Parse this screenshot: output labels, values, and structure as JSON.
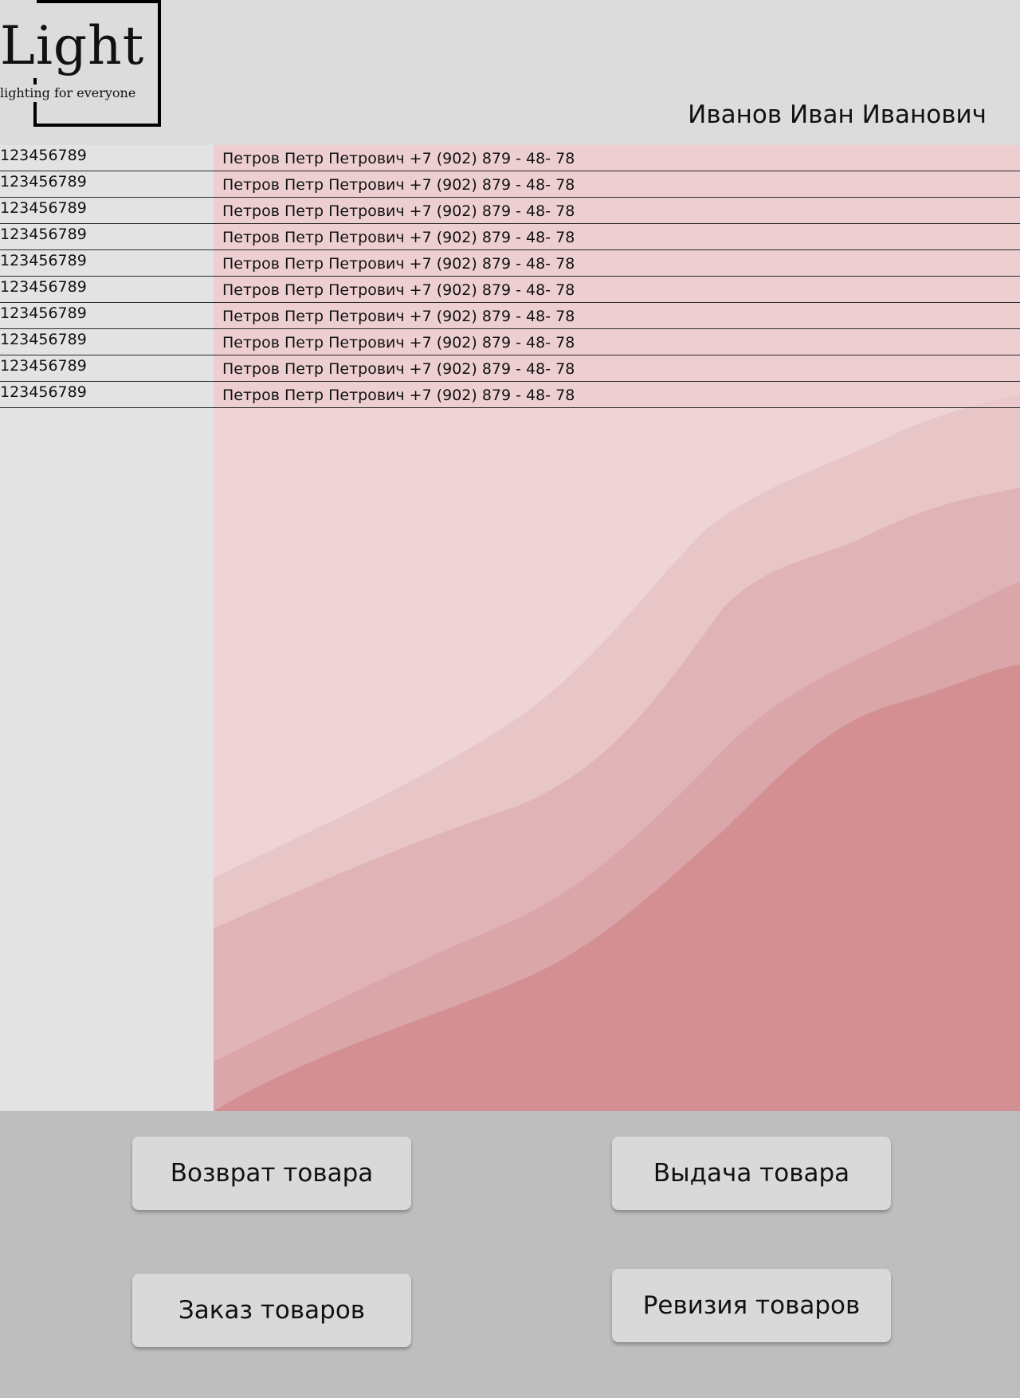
{
  "header": {
    "logo_word": "Light",
    "logo_tagline": "lighting for everyone",
    "user_name": "Иванов Иван Иванович"
  },
  "rows": [
    {
      "code": "123456789",
      "contact": "Петров Петр Петрович +7 (902) 879 - 48- 78"
    },
    {
      "code": "123456789",
      "contact": "Петров Петр Петрович +7 (902) 879 - 48- 78"
    },
    {
      "code": "123456789",
      "contact": "Петров Петр Петрович +7 (902) 879 - 48- 78"
    },
    {
      "code": "123456789",
      "contact": "Петров Петр Петрович +7 (902) 879 - 48- 78"
    },
    {
      "code": "123456789",
      "contact": "Петров Петр Петрович +7 (902) 879 - 48- 78"
    },
    {
      "code": "123456789",
      "contact": "Петров Петр Петрович +7 (902) 879 - 48- 78"
    },
    {
      "code": "123456789",
      "contact": "Петров Петр Петрович +7 (902) 879 - 48- 78"
    },
    {
      "code": "123456789",
      "contact": "Петров Петр Петрович +7 (902) 879 - 48- 78"
    },
    {
      "code": "123456789",
      "contact": "Петров Петр Петрович +7 (902) 879 - 48- 78"
    },
    {
      "code": "123456789",
      "contact": "Петров Петр Петрович +7 (902) 879 - 48- 78"
    }
  ],
  "actions": {
    "return_label": "Возврат товара",
    "issue_label": "Выдача товара",
    "order_label": "Заказ товаров",
    "audit_label": "Ревизия товаров"
  },
  "colors": {
    "header_bg": "#dcdcdc",
    "panel_bg": "#e3e3e3",
    "actions_bg": "#bebebe",
    "button_bg": "#d9d9d9",
    "pink_light": "#eed4d6",
    "pink_dark": "#d38f92"
  }
}
